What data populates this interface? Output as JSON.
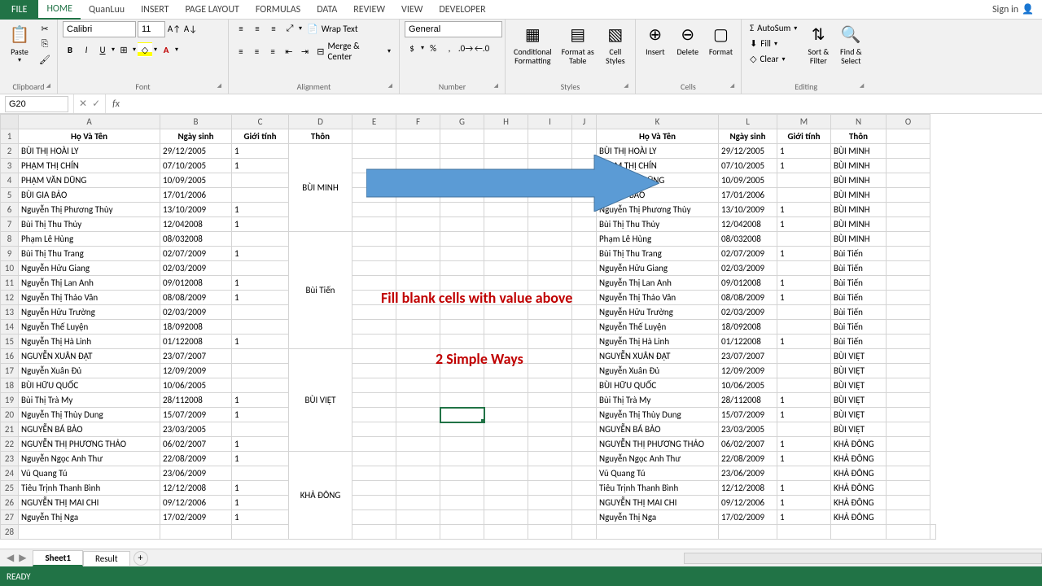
{
  "ribbon_tabs": {
    "file": "FILE",
    "home": "HOME",
    "quanluu": "QuanLuu",
    "insert": "INSERT",
    "page_layout": "PAGE LAYOUT",
    "formulas": "FORMULAS",
    "data": "DATA",
    "review": "REVIEW",
    "view": "VIEW",
    "developer": "DEVELOPER"
  },
  "signin": "Sign in",
  "ribbon": {
    "clipboard": {
      "paste": "Paste",
      "label": "Clipboard"
    },
    "font": {
      "name": "Calibri",
      "size": "11",
      "label": "Font"
    },
    "alignment": {
      "wrap": "Wrap Text",
      "merge": "Merge & Center",
      "label": "Alignment"
    },
    "number": {
      "format": "General",
      "label": "Number"
    },
    "styles": {
      "cond": "Conditional\nFormatting",
      "table": "Format as\nTable",
      "cell": "Cell\nStyles",
      "label": "Styles"
    },
    "cells": {
      "insert": "Insert",
      "delete": "Delete",
      "format": "Format",
      "label": "Cells"
    },
    "editing": {
      "autosum": "AutoSum",
      "fill": "Fill",
      "clear": "Clear",
      "sort": "Sort &\nFilter",
      "find": "Find &\nSelect",
      "label": "Editing"
    }
  },
  "name_box": "G20",
  "formula": "",
  "columns": [
    "A",
    "B",
    "C",
    "D",
    "E",
    "F",
    "G",
    "H",
    "I",
    "J",
    "K",
    "L",
    "M",
    "N",
    "O"
  ],
  "headers": {
    "name": "Họ Và Tên",
    "dob": "Ngày sinh",
    "sex": "Giới tính",
    "village": "Thôn"
  },
  "left_data": [
    {
      "name": "BÙI THỊ HOÀI  LY",
      "dob": "29/12/2005",
      "sex": "1"
    },
    {
      "name": "PHẠM THỊ  CHÍN",
      "dob": "07/10/2005",
      "sex": "1"
    },
    {
      "name": "PHẠM VĂN DŨNG",
      "dob": "10/09/2005",
      "sex": ""
    },
    {
      "name": "BÙI GIA BẢO",
      "dob": "17/01/2006",
      "sex": ""
    },
    {
      "name": "Nguyễn Thị Phương Thùy",
      "dob": "13/10/2009",
      "sex": "1"
    },
    {
      "name": "Bùi Thị Thu Thủy",
      "dob": "12/042008",
      "sex": "1"
    },
    {
      "name": "Phạm Lê Hùng",
      "dob": "08/032008",
      "sex": ""
    },
    {
      "name": "Bùi Thị Thu Trang",
      "dob": "02/07/2009",
      "sex": "1"
    },
    {
      "name": "Nguyễn Hữu Giang",
      "dob": "02/03/2009",
      "sex": ""
    },
    {
      "name": "Nguyễn Thị Lan Anh",
      "dob": "09/012008",
      "sex": "1"
    },
    {
      "name": "Nguyễn Thị Thảo Vân",
      "dob": "08/08/2009",
      "sex": "1"
    },
    {
      "name": "Nguyễn Hữu Trường",
      "dob": "02/03/2009",
      "sex": ""
    },
    {
      "name": "Nguyễn Thế Luyện",
      "dob": "18/092008",
      "sex": ""
    },
    {
      "name": "Nguyễn Thị Hà Linh",
      "dob": "01/122008",
      "sex": "1"
    },
    {
      "name": "NGUYỄN XUÂN  ĐẠT",
      "dob": "23/07/2007",
      "sex": ""
    },
    {
      "name": "Nguyễn Xuân Đủ",
      "dob": "12/09/2009",
      "sex": ""
    },
    {
      "name": "BÙI HỮU QUỐC",
      "dob": "10/06/2005",
      "sex": ""
    },
    {
      "name": "Bùi Thị Trà My",
      "dob": "28/112008",
      "sex": "1"
    },
    {
      "name": "Nguyễn Thị Thùy Dung",
      "dob": "15/07/2009",
      "sex": "1"
    },
    {
      "name": "NGUYỄN BÁ BẢO",
      "dob": "23/03/2005",
      "sex": ""
    },
    {
      "name": "NGUYỄN THỊ PHƯƠNG  THẢO",
      "dob": "06/02/2007",
      "sex": "1"
    },
    {
      "name": "Nguyễn Ngọc Anh Thư",
      "dob": "22/08/2009",
      "sex": "1"
    },
    {
      "name": "Vũ Quang Tú",
      "dob": "23/06/2009",
      "sex": ""
    },
    {
      "name": "Tiêu Trịnh Thanh Bình",
      "dob": "12/12/2008",
      "sex": "1"
    },
    {
      "name": "NGUYỄN THỊ MAI CHI",
      "dob": "09/12/2006",
      "sex": "1"
    },
    {
      "name": "Nguyễn Thị Nga",
      "dob": "17/02/2009",
      "sex": "1"
    }
  ],
  "villages_left": [
    {
      "name": "BÙI MINH",
      "span": 6
    },
    {
      "name": "Bùi Tiến",
      "span": 8
    },
    {
      "name": "BÙI VIỆT",
      "span": 7
    },
    {
      "name": "KHẢ ĐÔNG",
      "span": 6
    }
  ],
  "right_data": [
    {
      "name": "BÙI THỊ HOÀI  LY",
      "dob": "29/12/2005",
      "sex": "1",
      "vil": "BÙI MINH"
    },
    {
      "name": "PHẠM THỊ  CHÍN",
      "dob": "07/10/2005",
      "sex": "1",
      "vil": "BÙI MINH"
    },
    {
      "name": "PHẠM VĂN DŨNG",
      "dob": "10/09/2005",
      "sex": "",
      "vil": "BÙI MINH"
    },
    {
      "name": "BÙI GIA BẢO",
      "dob": "17/01/2006",
      "sex": "",
      "vil": "BÙI MINH"
    },
    {
      "name": "Nguyễn Thị Phương Thùy",
      "dob": "13/10/2009",
      "sex": "1",
      "vil": "BÙI MINH"
    },
    {
      "name": "Bùi Thị Thu Thủy",
      "dob": "12/042008",
      "sex": "1",
      "vil": "BÙI MINH"
    },
    {
      "name": "Phạm Lê Hùng",
      "dob": "08/032008",
      "sex": "",
      "vil": "BÙI MINH"
    },
    {
      "name": "Bùi Thị Thu Trang",
      "dob": "02/07/2009",
      "sex": "1",
      "vil": "Bùi Tiến"
    },
    {
      "name": "Nguyễn Hữu Giang",
      "dob": "02/03/2009",
      "sex": "",
      "vil": "Bùi Tiến"
    },
    {
      "name": "Nguyễn Thị Lan Anh",
      "dob": "09/012008",
      "sex": "1",
      "vil": "Bùi Tiến"
    },
    {
      "name": "Nguyễn Thị Thảo Vân",
      "dob": "08/08/2009",
      "sex": "1",
      "vil": "Bùi Tiến"
    },
    {
      "name": "Nguyễn Hữu Trường",
      "dob": "02/03/2009",
      "sex": "",
      "vil": "Bùi Tiến"
    },
    {
      "name": "Nguyễn Thế Luyện",
      "dob": "18/092008",
      "sex": "",
      "vil": "Bùi Tiến"
    },
    {
      "name": "Nguyễn Thị Hà Linh",
      "dob": "01/122008",
      "sex": "1",
      "vil": "Bùi Tiến"
    },
    {
      "name": "NGUYỄN XUÂN  ĐẠT",
      "dob": "23/07/2007",
      "sex": "",
      "vil": "BÙI VIỆT"
    },
    {
      "name": "Nguyễn Xuân Đủ",
      "dob": "12/09/2009",
      "sex": "",
      "vil": "BÙI VIỆT"
    },
    {
      "name": "BÙI HỮU QUỐC",
      "dob": "10/06/2005",
      "sex": "",
      "vil": "BÙI VIỆT"
    },
    {
      "name": "Bùi Thị Trà My",
      "dob": "28/112008",
      "sex": "1",
      "vil": "BÙI VIỆT"
    },
    {
      "name": "Nguyễn Thị Thùy Dung",
      "dob": "15/07/2009",
      "sex": "1",
      "vil": "BÙI VIỆT"
    },
    {
      "name": "NGUYỄN BÁ BẢO",
      "dob": "23/03/2005",
      "sex": "",
      "vil": "BÙI VIỆT"
    },
    {
      "name": "NGUYỄN THỊ PHƯƠNG  THẢO",
      "dob": "06/02/2007",
      "sex": "1",
      "vil": "KHẢ ĐÔNG"
    },
    {
      "name": "Nguyễn Ngọc Anh Thư",
      "dob": "22/08/2009",
      "sex": "1",
      "vil": "KHẢ ĐÔNG"
    },
    {
      "name": "Vũ Quang Tú",
      "dob": "23/06/2009",
      "sex": "",
      "vil": "KHẢ ĐÔNG"
    },
    {
      "name": "Tiêu Trịnh Thanh Bình",
      "dob": "12/12/2008",
      "sex": "1",
      "vil": "KHẢ ĐÔNG"
    },
    {
      "name": "NGUYỄN THỊ MAI CHI",
      "dob": "09/12/2006",
      "sex": "1",
      "vil": "KHẢ ĐÔNG"
    },
    {
      "name": "Nguyễn Thị Nga",
      "dob": "17/02/2009",
      "sex": "1",
      "vil": "KHẢ ĐÔNG"
    }
  ],
  "annotation1": "Fill blank cells with value above",
  "annotation2": "2 Simple Ways",
  "sheets": {
    "sheet1": "Sheet1",
    "result": "Result"
  },
  "status": "READY"
}
